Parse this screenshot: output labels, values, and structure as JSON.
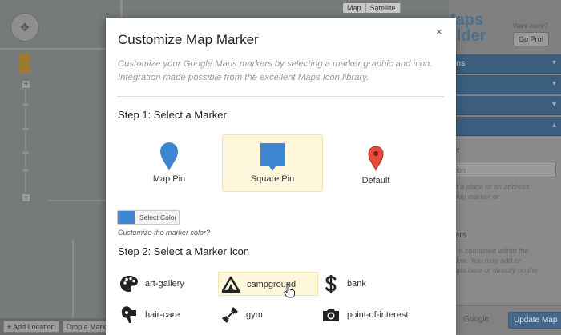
{
  "map": {
    "type_buttons": [
      "Map",
      "Satellite"
    ],
    "bottom_buttons": [
      "Add Location",
      "Drop a Marker"
    ]
  },
  "sidebar": {
    "logo_line1": "Maps",
    "logo_line2": "uilder",
    "want_more": "Want more?",
    "go_pro": "Go Pro!",
    "accordion": [
      "ons",
      "",
      "",
      ""
    ],
    "panel_heading": "er",
    "panel_input": "ion",
    "panel_text1": "of a place or an address",
    "panel_text2": "map marker or",
    "panel_heading2": "ters",
    "panel_text3": "s is contained within the",
    "panel_text4": "elow. You may add or",
    "panel_text5": "data here or directly on the",
    "panel_text6": "n.",
    "google": "Google",
    "update_button": "Update Map"
  },
  "modal": {
    "title": "Customize Map Marker",
    "close": "×",
    "description_line1": "Customize your Google Maps markers by selecting a marker graphic and icon.",
    "description_line2": "Integration made possible from the excellent Maps Icon library.",
    "step1": "Step 1: Select a Marker",
    "markers": [
      {
        "label": "Map Pin",
        "selected": false
      },
      {
        "label": "Square Pin",
        "selected": true
      },
      {
        "label": "Default",
        "selected": false
      }
    ],
    "marker_color": "#3e86d0",
    "select_color": "Select Color",
    "color_hint": "Customize the marker color?",
    "step2": "Step 2: Select a Marker Icon",
    "icons": [
      {
        "label": "art-gallery",
        "icon": "palette-icon"
      },
      {
        "label": "campground",
        "icon": "tent-icon",
        "hover": true
      },
      {
        "label": "bank",
        "icon": "dollar-icon"
      },
      {
        "label": "hair-care",
        "icon": "hair-dryer-icon"
      },
      {
        "label": "gym",
        "icon": "dumbbell-icon"
      },
      {
        "label": "point-of-interest",
        "icon": "camera-icon"
      }
    ]
  }
}
